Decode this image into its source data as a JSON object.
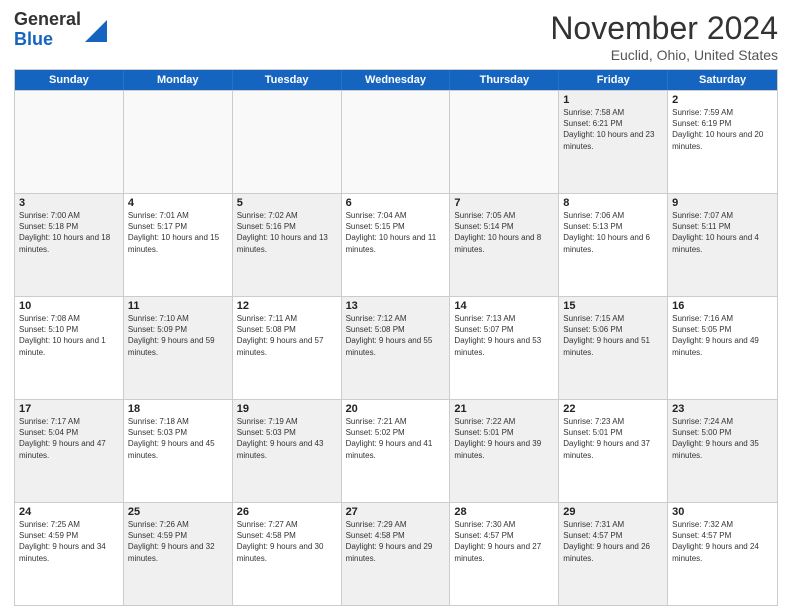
{
  "header": {
    "logo_line1": "General",
    "logo_line2": "Blue",
    "month_title": "November 2024",
    "location": "Euclid, Ohio, United States"
  },
  "days_of_week": [
    "Sunday",
    "Monday",
    "Tuesday",
    "Wednesday",
    "Thursday",
    "Friday",
    "Saturday"
  ],
  "rows": [
    [
      {
        "day": "",
        "info": "",
        "empty": true
      },
      {
        "day": "",
        "info": "",
        "empty": true
      },
      {
        "day": "",
        "info": "",
        "empty": true
      },
      {
        "day": "",
        "info": "",
        "empty": true
      },
      {
        "day": "",
        "info": "",
        "empty": true
      },
      {
        "day": "1",
        "info": "Sunrise: 7:58 AM\nSunset: 6:21 PM\nDaylight: 10 hours and 23 minutes.",
        "empty": false,
        "shaded": true
      },
      {
        "day": "2",
        "info": "Sunrise: 7:59 AM\nSunset: 6:19 PM\nDaylight: 10 hours and 20 minutes.",
        "empty": false,
        "shaded": false
      }
    ],
    [
      {
        "day": "3",
        "info": "Sunrise: 7:00 AM\nSunset: 5:18 PM\nDaylight: 10 hours and 18 minutes.",
        "empty": false,
        "shaded": true
      },
      {
        "day": "4",
        "info": "Sunrise: 7:01 AM\nSunset: 5:17 PM\nDaylight: 10 hours and 15 minutes.",
        "empty": false,
        "shaded": false
      },
      {
        "day": "5",
        "info": "Sunrise: 7:02 AM\nSunset: 5:16 PM\nDaylight: 10 hours and 13 minutes.",
        "empty": false,
        "shaded": true
      },
      {
        "day": "6",
        "info": "Sunrise: 7:04 AM\nSunset: 5:15 PM\nDaylight: 10 hours and 11 minutes.",
        "empty": false,
        "shaded": false
      },
      {
        "day": "7",
        "info": "Sunrise: 7:05 AM\nSunset: 5:14 PM\nDaylight: 10 hours and 8 minutes.",
        "empty": false,
        "shaded": true
      },
      {
        "day": "8",
        "info": "Sunrise: 7:06 AM\nSunset: 5:13 PM\nDaylight: 10 hours and 6 minutes.",
        "empty": false,
        "shaded": false
      },
      {
        "day": "9",
        "info": "Sunrise: 7:07 AM\nSunset: 5:11 PM\nDaylight: 10 hours and 4 minutes.",
        "empty": false,
        "shaded": true
      }
    ],
    [
      {
        "day": "10",
        "info": "Sunrise: 7:08 AM\nSunset: 5:10 PM\nDaylight: 10 hours and 1 minute.",
        "empty": false,
        "shaded": false
      },
      {
        "day": "11",
        "info": "Sunrise: 7:10 AM\nSunset: 5:09 PM\nDaylight: 9 hours and 59 minutes.",
        "empty": false,
        "shaded": true
      },
      {
        "day": "12",
        "info": "Sunrise: 7:11 AM\nSunset: 5:08 PM\nDaylight: 9 hours and 57 minutes.",
        "empty": false,
        "shaded": false
      },
      {
        "day": "13",
        "info": "Sunrise: 7:12 AM\nSunset: 5:08 PM\nDaylight: 9 hours and 55 minutes.",
        "empty": false,
        "shaded": true
      },
      {
        "day": "14",
        "info": "Sunrise: 7:13 AM\nSunset: 5:07 PM\nDaylight: 9 hours and 53 minutes.",
        "empty": false,
        "shaded": false
      },
      {
        "day": "15",
        "info": "Sunrise: 7:15 AM\nSunset: 5:06 PM\nDaylight: 9 hours and 51 minutes.",
        "empty": false,
        "shaded": true
      },
      {
        "day": "16",
        "info": "Sunrise: 7:16 AM\nSunset: 5:05 PM\nDaylight: 9 hours and 49 minutes.",
        "empty": false,
        "shaded": false
      }
    ],
    [
      {
        "day": "17",
        "info": "Sunrise: 7:17 AM\nSunset: 5:04 PM\nDaylight: 9 hours and 47 minutes.",
        "empty": false,
        "shaded": true
      },
      {
        "day": "18",
        "info": "Sunrise: 7:18 AM\nSunset: 5:03 PM\nDaylight: 9 hours and 45 minutes.",
        "empty": false,
        "shaded": false
      },
      {
        "day": "19",
        "info": "Sunrise: 7:19 AM\nSunset: 5:03 PM\nDaylight: 9 hours and 43 minutes.",
        "empty": false,
        "shaded": true
      },
      {
        "day": "20",
        "info": "Sunrise: 7:21 AM\nSunset: 5:02 PM\nDaylight: 9 hours and 41 minutes.",
        "empty": false,
        "shaded": false
      },
      {
        "day": "21",
        "info": "Sunrise: 7:22 AM\nSunset: 5:01 PM\nDaylight: 9 hours and 39 minutes.",
        "empty": false,
        "shaded": true
      },
      {
        "day": "22",
        "info": "Sunrise: 7:23 AM\nSunset: 5:01 PM\nDaylight: 9 hours and 37 minutes.",
        "empty": false,
        "shaded": false
      },
      {
        "day": "23",
        "info": "Sunrise: 7:24 AM\nSunset: 5:00 PM\nDaylight: 9 hours and 35 minutes.",
        "empty": false,
        "shaded": true
      }
    ],
    [
      {
        "day": "24",
        "info": "Sunrise: 7:25 AM\nSunset: 4:59 PM\nDaylight: 9 hours and 34 minutes.",
        "empty": false,
        "shaded": false
      },
      {
        "day": "25",
        "info": "Sunrise: 7:26 AM\nSunset: 4:59 PM\nDaylight: 9 hours and 32 minutes.",
        "empty": false,
        "shaded": true
      },
      {
        "day": "26",
        "info": "Sunrise: 7:27 AM\nSunset: 4:58 PM\nDaylight: 9 hours and 30 minutes.",
        "empty": false,
        "shaded": false
      },
      {
        "day": "27",
        "info": "Sunrise: 7:29 AM\nSunset: 4:58 PM\nDaylight: 9 hours and 29 minutes.",
        "empty": false,
        "shaded": true
      },
      {
        "day": "28",
        "info": "Sunrise: 7:30 AM\nSunset: 4:57 PM\nDaylight: 9 hours and 27 minutes.",
        "empty": false,
        "shaded": false
      },
      {
        "day": "29",
        "info": "Sunrise: 7:31 AM\nSunset: 4:57 PM\nDaylight: 9 hours and 26 minutes.",
        "empty": false,
        "shaded": true
      },
      {
        "day": "30",
        "info": "Sunrise: 7:32 AM\nSunset: 4:57 PM\nDaylight: 9 hours and 24 minutes.",
        "empty": false,
        "shaded": false
      }
    ]
  ]
}
